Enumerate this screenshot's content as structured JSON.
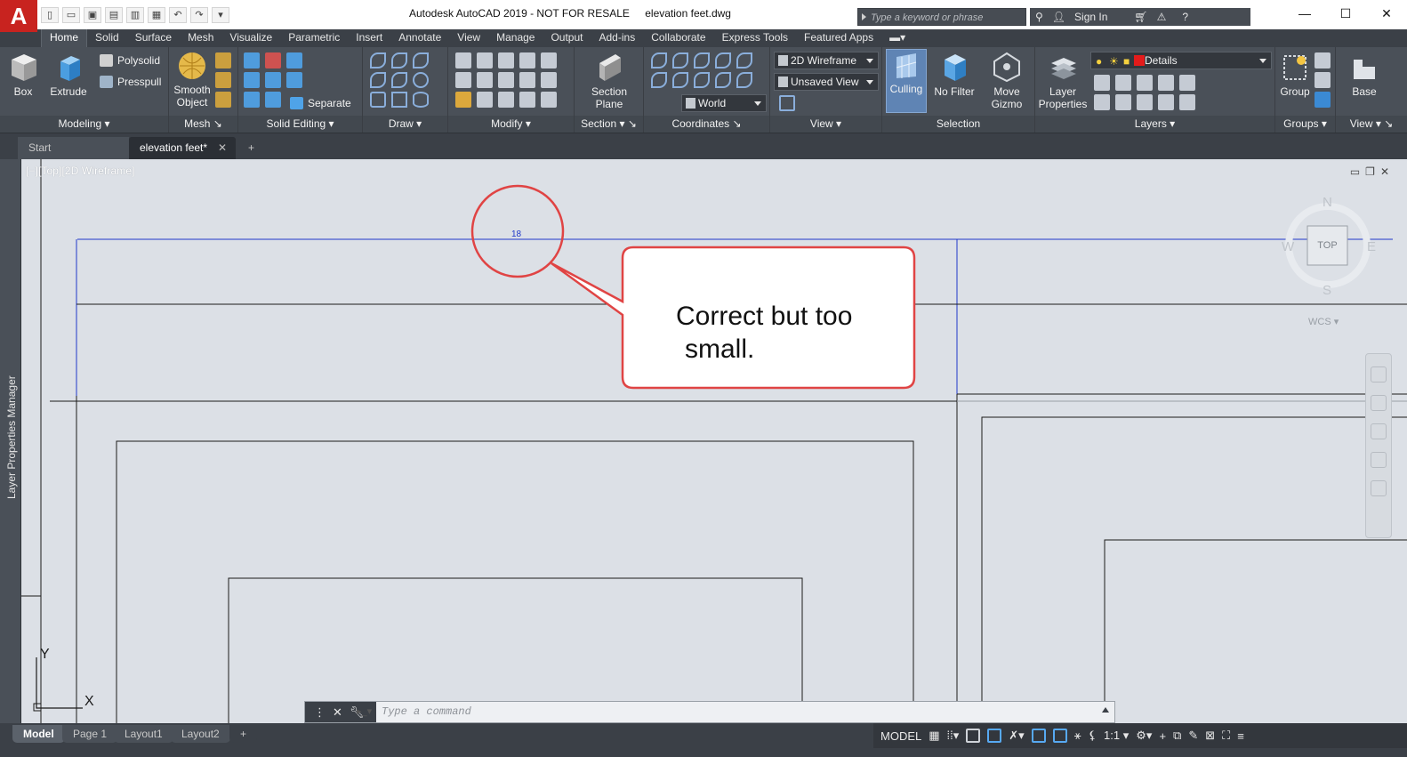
{
  "app": {
    "logo_letter": "A",
    "title": "Autodesk AutoCAD 2019 - NOT FOR RESALE",
    "document": "elevation feet.dwg",
    "search_placeholder": "Type a keyword or phrase",
    "sign_in": "Sign In"
  },
  "ribbon_tabs": [
    "Home",
    "Solid",
    "Surface",
    "Mesh",
    "Visualize",
    "Parametric",
    "Insert",
    "Annotate",
    "View",
    "Manage",
    "Output",
    "Add-ins",
    "Collaborate",
    "Express Tools",
    "Featured Apps"
  ],
  "panels": {
    "modeling": {
      "title": "Modeling",
      "box": "Box",
      "extrude": "Extrude",
      "polysolid": "Polysolid",
      "presspull": "Presspull"
    },
    "mesh": {
      "title": "Mesh",
      "smooth_1": "Smooth",
      "smooth_2": "Object"
    },
    "solid_editing": {
      "title": "Solid Editing",
      "separate": "Separate"
    },
    "draw": {
      "title": "Draw"
    },
    "modify": {
      "title": "Modify"
    },
    "section": {
      "title": "Section",
      "plane_1": "Section",
      "plane_2": "Plane"
    },
    "coordinates": {
      "title": "Coordinates",
      "ucs": "World"
    },
    "view": {
      "title": "View",
      "visual_style": "2D Wireframe",
      "named_view": "Unsaved View"
    },
    "selection": {
      "title": "Selection",
      "culling": "Culling",
      "no_filter": "No Filter",
      "move_1": "Move",
      "move_2": "Gizmo"
    },
    "layers": {
      "title": "Layers",
      "props_1": "Layer",
      "props_2": "Properties",
      "current_layer": "Details"
    },
    "groups": {
      "title": "Groups",
      "group": "Group"
    },
    "view2": {
      "title": "View",
      "base": "Base"
    }
  },
  "file_tabs": {
    "start": "Start",
    "current": "elevation feet*",
    "new": "+"
  },
  "viewport": {
    "label": "[−][Top][2D Wireframe]"
  },
  "side_palette": {
    "label": "Layer Properties Manager"
  },
  "viewcube": {
    "north": "N",
    "south": "S",
    "east": "E",
    "west": "W",
    "face": "TOP",
    "wcs": "WCS"
  },
  "annotation": {
    "dimension_value": "18",
    "callout_line1": "Correct but too",
    "callout_line2": "small."
  },
  "ucs_icon": {
    "y": "Y",
    "x": "X"
  },
  "command": {
    "placeholder": "Type a command"
  },
  "layout_tabs": [
    "Model",
    "Page 1",
    "Layout1",
    "Layout2"
  ],
  "status": {
    "mode": "MODEL",
    "scale": "1:1"
  },
  "colors": {
    "accent": "#e04444",
    "dimension": "#1f37c9",
    "viewport_bg": "#dce0e6",
    "ribbon_bg": "#4a5058",
    "logo": "#c8231f"
  }
}
